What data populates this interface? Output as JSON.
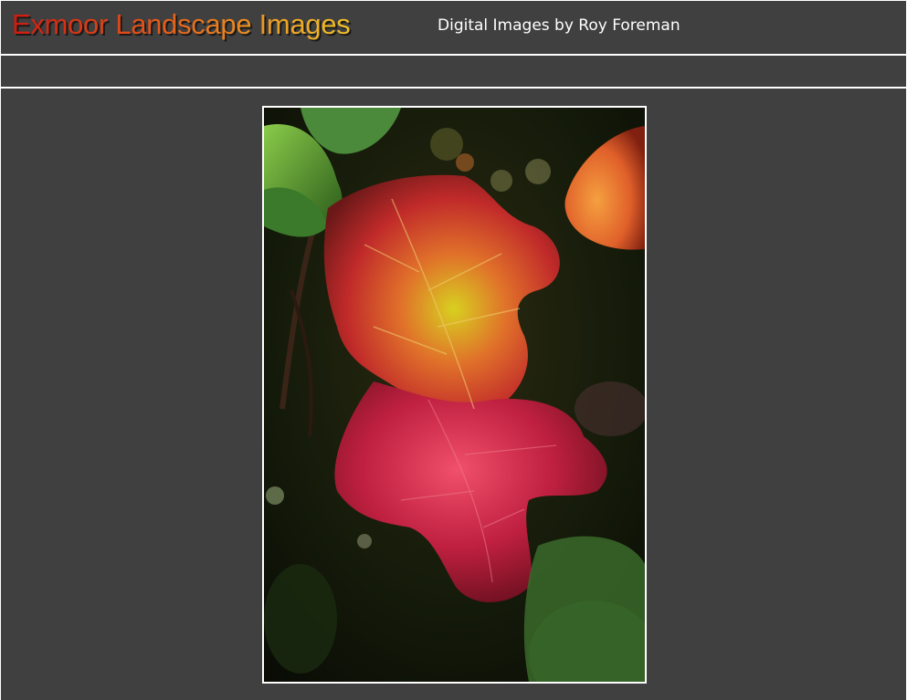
{
  "header": {
    "title": "Exmoor Landscape Images",
    "subtitle": "Digital Images by Roy Foreman"
  },
  "photo": {
    "subject": "leaf-photo"
  },
  "colors": {
    "background": "#404040",
    "border": "#ffffff",
    "title_gradient_start": "#d01a10",
    "title_gradient_end": "#f0c028",
    "subtitle": "#ffffff"
  }
}
